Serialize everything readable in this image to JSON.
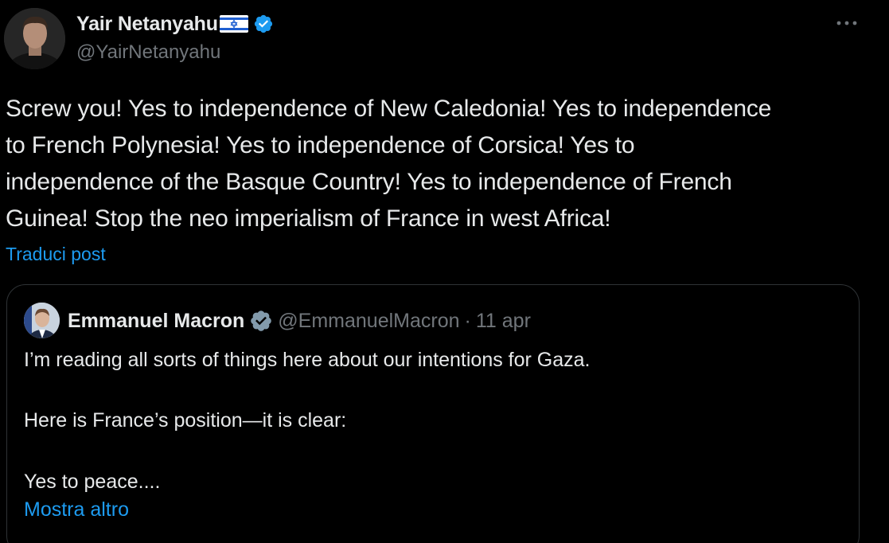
{
  "author": {
    "name": "Yair Netanyahu",
    "handle": "@YairNetanyahu",
    "flag_icon": "israel-flag-icon",
    "verified_icon": "verified-badge-icon",
    "verified_color": "#1d9bf0"
  },
  "tweet": {
    "lines": [
      "Screw you! Yes to independence of New Caledonia! Yes to independence",
      "to French Polynesia! Yes to independence of Corsica! Yes to",
      "independence of the Basque Country! Yes to independence of French",
      "Guinea! Stop the neo imperialism of France in west Africa!"
    ],
    "translate_label": "Traduci post"
  },
  "quoted": {
    "name": "Emmanuel Macron",
    "verified_icon": "gray-verified-badge-icon",
    "handle": "@EmmanuelMacron",
    "separator": "·",
    "date": "11 apr",
    "lines": [
      "I’m reading all sorts of things here about our intentions for Gaza.",
      "Here is France’s position—it is clear:",
      "Yes to peace...."
    ],
    "show_more_label": "Mostra altro"
  },
  "colors": {
    "background": "#000000",
    "text": "#e7e9ea",
    "secondary": "#71767b",
    "link": "#1d9bf0",
    "border": "#2f3336"
  }
}
